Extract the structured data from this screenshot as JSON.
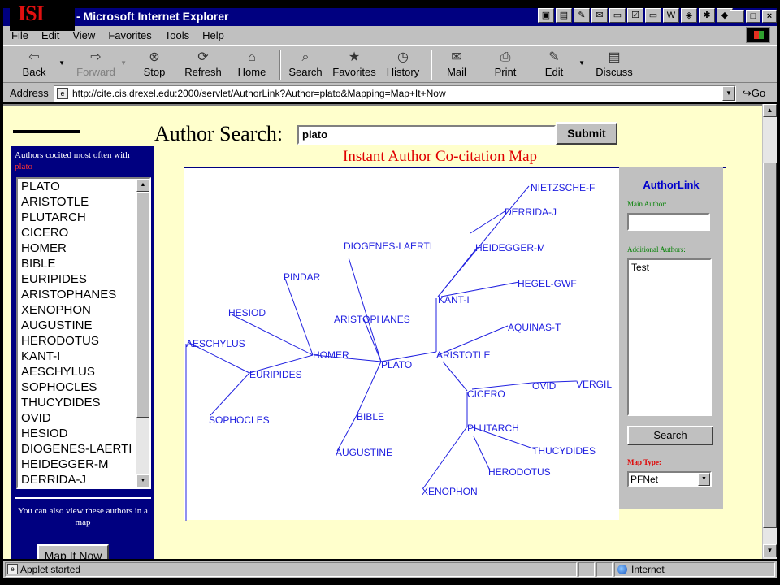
{
  "window": {
    "logo_text": "ISI",
    "title": "- Microsoft Internet Explorer",
    "tray_icons": [
      "app-icon",
      "doc-icon",
      "tools-icon",
      "mail-icon",
      "window-icon",
      "check-icon",
      "window-icon",
      "word-icon",
      "folder-icon",
      "spider-icon",
      "cube-icon"
    ],
    "controls": {
      "minimize": "_",
      "restore": "□",
      "close": "×"
    }
  },
  "menu": [
    "File",
    "Edit",
    "View",
    "Favorites",
    "Tools",
    "Help"
  ],
  "toolbar": {
    "back": "Back",
    "forward": "Forward",
    "stop": "Stop",
    "refresh": "Refresh",
    "home": "Home",
    "search": "Search",
    "favorites": "Favorites",
    "history": "History",
    "mail": "Mail",
    "print": "Print",
    "edit": "Edit",
    "discuss": "Discuss"
  },
  "address": {
    "label": "Address",
    "url": "http://cite.cis.drexel.edu:2000/servlet/AuthorLink?Author=plato&Mapping=Map+It+Now",
    "go": "Go"
  },
  "page": {
    "search_label": "Author Search:",
    "search_value": "plato",
    "submit_label": "Submit",
    "map_title": "Instant Author Co-citation Map"
  },
  "left_panel": {
    "heading": "Authors cocited most often with",
    "term": "plato",
    "authors": [
      "PLATO",
      "ARISTOTLE",
      "PLUTARCH",
      "CICERO",
      "HOMER",
      "BIBLE",
      "EURIPIDES",
      "ARISTOPHANES",
      "XENOPHON",
      "AUGUSTINE",
      "HERODOTUS",
      "KANT-I",
      "AESCHYLUS",
      "SOPHOCLES",
      "THUCYDIDES",
      "OVID",
      "HESIOD",
      "DIOGENES-LAERTI",
      "HEIDEGGER-M",
      "DERRIDA-J"
    ],
    "note": "You can also view these authors in a map",
    "map_button": "Map It Now"
  },
  "map": {
    "nodes": [
      "NIETZSCHE-F",
      "DERRIDA-J",
      "HEIDEGGER-M",
      "DIOGENES-LAERTI",
      "HEGEL-GWF",
      "PINDAR",
      "KANT-I",
      "HESIOD",
      "ARISTOPHANES",
      "AQUINAS-T",
      "AESCHYLUS",
      "HOMER",
      "ARISTOTLE",
      "PLATO",
      "EURIPIDES",
      "OVID",
      "VERGIL",
      "CICERO",
      "SOPHOCLES",
      "BIBLE",
      "PLUTARCH",
      "AUGUSTINE",
      "THUCYDIDES",
      "HERODOTUS",
      "XENOPHON"
    ]
  },
  "authorlink": {
    "title": "AuthorLink",
    "main_label": "Main Author:",
    "main_value": "",
    "additional_label": "Additional Authors:",
    "additional_value": "Test",
    "search_button": "Search",
    "map_type_label": "Map Type:",
    "map_type_value": "PFNet"
  },
  "status": {
    "text": "Applet started",
    "zone": "Internet"
  }
}
